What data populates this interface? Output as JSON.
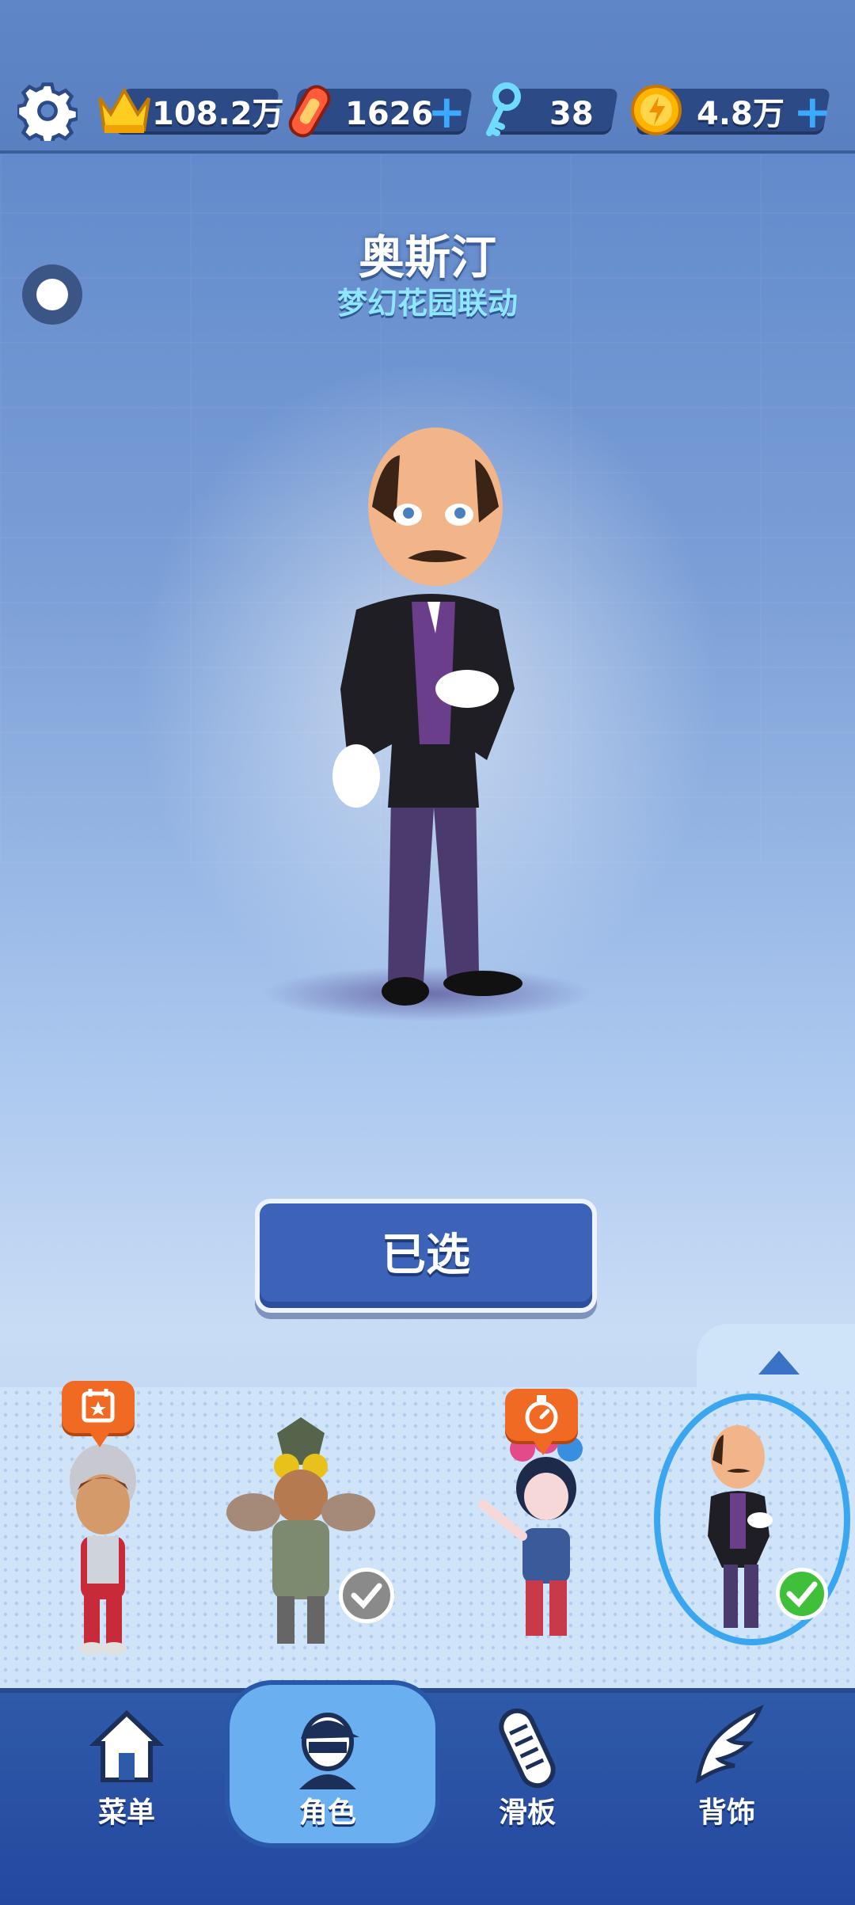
{
  "header": {
    "crowns": "108.2万",
    "hoverboards": "1626",
    "keys": "38",
    "coins": "4.8万",
    "plus_label": "+"
  },
  "character": {
    "name": "奥斯汀",
    "subtitle": "梦幻花园联动",
    "select_button": "已选"
  },
  "carousel": {
    "items": [
      {
        "name": "character-ultraman-girl",
        "badge": "calendar-icon"
      },
      {
        "name": "character-monster-armor",
        "status": "owned"
      },
      {
        "name": "character-opera-girl",
        "badge": "stopwatch-icon"
      },
      {
        "name": "character-austin",
        "status": "selected"
      }
    ]
  },
  "nav": {
    "items": [
      {
        "label": "菜单",
        "icon": "house-icon"
      },
      {
        "label": "角色",
        "icon": "character-icon",
        "active": true
      },
      {
        "label": "滑板",
        "icon": "skateboard-icon"
      },
      {
        "label": "背饰",
        "icon": "wing-icon"
      }
    ]
  },
  "colors": {
    "accent": "#3d63b8",
    "plus": "#3aa9ff",
    "badge": "#f06a23",
    "check": "#3fbf3a"
  }
}
